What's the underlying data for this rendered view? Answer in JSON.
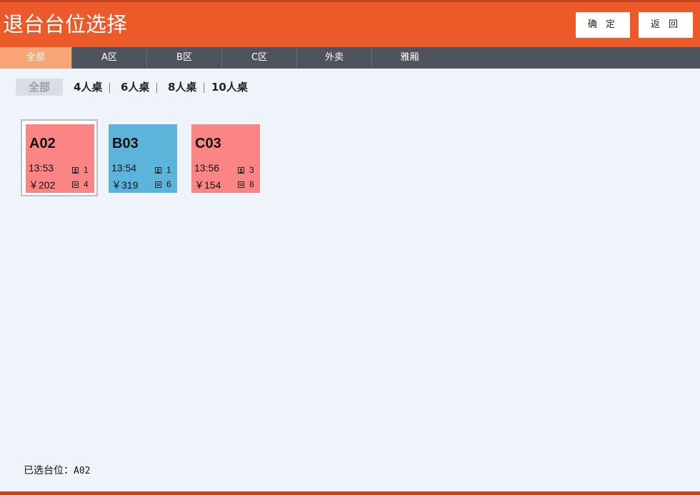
{
  "header": {
    "title": "退台台位选择",
    "confirm_label": "确 定",
    "back_label": "返 回"
  },
  "tabs": [
    {
      "label": "全部",
      "active": true
    },
    {
      "label": "A区",
      "active": false
    },
    {
      "label": "B区",
      "active": false
    },
    {
      "label": "C区",
      "active": false
    },
    {
      "label": "外卖",
      "active": false
    },
    {
      "label": "雅厢",
      "active": false
    }
  ],
  "filters": [
    {
      "label": "全部",
      "active": true
    },
    {
      "label": "4人桌",
      "active": false
    },
    {
      "label": "6人桌",
      "active": false
    },
    {
      "label": "8人桌",
      "active": false
    },
    {
      "label": "10人桌",
      "active": false
    }
  ],
  "tables": [
    {
      "name": "A02",
      "time": "13:53",
      "amount": "￥202",
      "guests": "1",
      "seats": "4",
      "color": "#fb8585",
      "selected": true
    },
    {
      "name": "B03",
      "time": "13:54",
      "amount": "￥319",
      "guests": "1",
      "seats": "6",
      "color": "#5db4da",
      "selected": false
    },
    {
      "name": "C03",
      "time": "13:56",
      "amount": "￥154",
      "guests": "3",
      "seats": "8",
      "color": "#fb8585",
      "selected": false
    }
  ],
  "status": {
    "label": "已选台位：",
    "value": "A02"
  },
  "colors": {
    "header": "#eb5a28",
    "tab_bar": "#4f535d",
    "tab_active": "#f8a577",
    "background": "#eff4fb"
  }
}
